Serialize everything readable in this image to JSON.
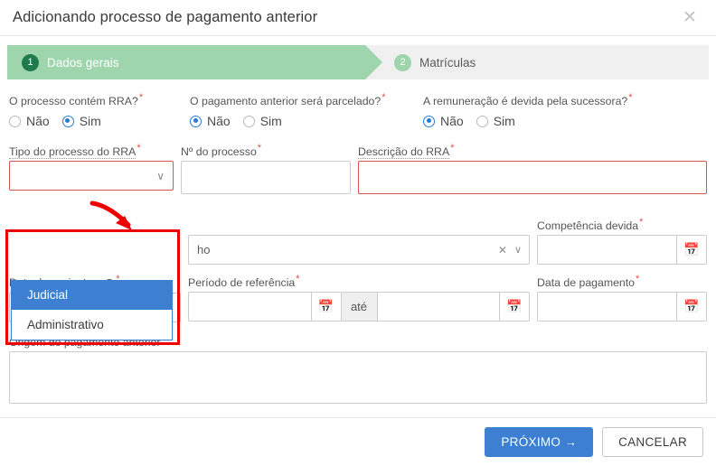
{
  "header": {
    "title": "Adicionando processo de pagamento anterior",
    "close_label": "✕"
  },
  "steps": [
    {
      "number": "1",
      "label": "Dados gerais",
      "state": "active"
    },
    {
      "number": "2",
      "label": "Matrículas",
      "state": "inactive"
    }
  ],
  "form": {
    "q_rra": {
      "label": "O processo contém RRA?",
      "required": "*",
      "options": [
        {
          "label": "Não",
          "selected": false
        },
        {
          "label": "Sim",
          "selected": true
        }
      ]
    },
    "q_parcelado": {
      "label": "O pagamento anterior será parcelado?",
      "required": "*",
      "options": [
        {
          "label": "Não",
          "selected": true
        },
        {
          "label": "Sim",
          "selected": false
        }
      ]
    },
    "q_sucessora": {
      "label": "A remuneração é devida pela sucessora?",
      "required": "*",
      "options": [
        {
          "label": "Não",
          "selected": true
        },
        {
          "label": "Sim",
          "selected": false
        }
      ]
    },
    "tipo_processo_rra": {
      "label": "Tipo do processo do RRA",
      "required": "*",
      "value": "",
      "caret": "∨",
      "options": [
        {
          "label": "Judicial",
          "highlighted": true
        },
        {
          "label": "Administrativo",
          "highlighted": false
        }
      ]
    },
    "numero_processo": {
      "label": "Nº do processo",
      "required": "*",
      "value": ""
    },
    "descricao_rra": {
      "label": "Descrição do RRA",
      "required": "*",
      "value": ""
    },
    "multiselect_hidden": {
      "value": "ho",
      "clear": "✕",
      "caret": "∨"
    },
    "competencia_devida": {
      "label": "Competência devida",
      "required": "*",
      "value": "",
      "calendar_icon": "📅"
    },
    "data_assinatura": {
      "label": "Data da assinatura",
      "required": "*",
      "help": "?",
      "value": "",
      "calendar_icon": "📅"
    },
    "periodo_referencia": {
      "label": "Período de referência",
      "required": "*",
      "start_value": "",
      "separator": "até",
      "end_value": "",
      "calendar_icon": "📅"
    },
    "data_pagamento": {
      "label": "Data de pagamento",
      "required": "*",
      "value": "",
      "calendar_icon": "📅"
    },
    "origem_pagamento": {
      "label": "Origem do pagamento anterior",
      "required": "*",
      "value": ""
    }
  },
  "footer": {
    "next_label": "PRÓXIMO →",
    "cancel_label": "CANCELAR"
  },
  "colors": {
    "accent_blue": "#3d7fd0",
    "step_active_green": "#9ed5ad",
    "step_badge_green": "#1f7a4d",
    "error_red": "#d9534f",
    "annotation_red": "#ee0000"
  }
}
